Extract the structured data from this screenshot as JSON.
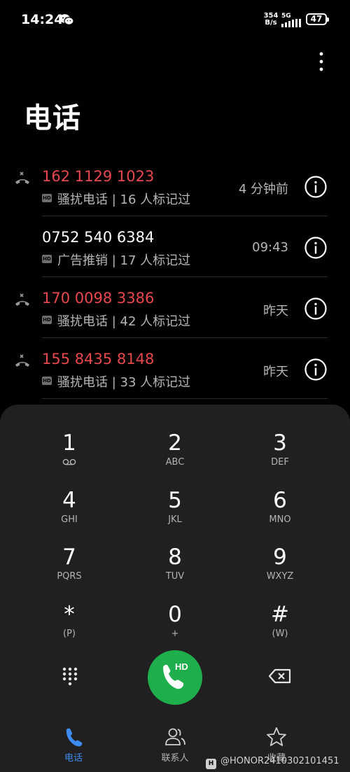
{
  "status_bar": {
    "time": "14:24",
    "net_speed_value": "354",
    "net_speed_unit": "B/s",
    "network": "5G",
    "battery": "47"
  },
  "header": {
    "title": "电话"
  },
  "calls": [
    {
      "number": "162 1129 1023",
      "missed": true,
      "tag": "HD",
      "desc": "骚扰电话 | 16 人标记过",
      "time": "4 分钟前"
    },
    {
      "number": "0752 540 6384",
      "missed": false,
      "tag": "HD",
      "desc": "广告推销 | 17 人标记过",
      "time": "09:43"
    },
    {
      "number": "170 0098 3386",
      "missed": true,
      "tag": "HD",
      "desc": "骚扰电话 | 42 人标记过",
      "time": "昨天"
    },
    {
      "number": "155 8435 8148",
      "missed": true,
      "tag": "HD",
      "desc": "骚扰电话 | 33 人标记过",
      "time": "昨天"
    }
  ],
  "dialpad": {
    "keys": [
      {
        "digit": "1",
        "letters": ""
      },
      {
        "digit": "2",
        "letters": "ABC"
      },
      {
        "digit": "3",
        "letters": "DEF"
      },
      {
        "digit": "4",
        "letters": "GHI"
      },
      {
        "digit": "5",
        "letters": "JKL"
      },
      {
        "digit": "6",
        "letters": "MNO"
      },
      {
        "digit": "7",
        "letters": "PQRS"
      },
      {
        "digit": "8",
        "letters": "TUV"
      },
      {
        "digit": "9",
        "letters": "WXYZ"
      },
      {
        "digit": "*",
        "letters": "(P)"
      },
      {
        "digit": "0",
        "letters": "+"
      },
      {
        "digit": "#",
        "letters": "(W)"
      }
    ],
    "call_hd_label": "HD"
  },
  "nav": {
    "items": [
      {
        "label": "电话",
        "active": true
      },
      {
        "label": "联系人",
        "active": false
      },
      {
        "label": "收藏",
        "active": false
      }
    ]
  },
  "watermark": {
    "badge": "H",
    "text": "@HONOR2410302101451"
  },
  "colors": {
    "missed": "#e6484e",
    "accent": "#3e8bf2",
    "call_green": "#1fae4c",
    "panel": "#202020"
  }
}
